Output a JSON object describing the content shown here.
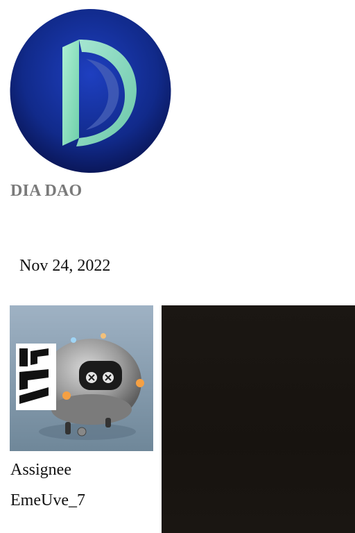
{
  "org": {
    "name": "DIA DAO",
    "logo_icon": "dia-dao-logo-icon",
    "colors": {
      "logo_bg_outer": "#0b1a63",
      "logo_bg_inner": "#1a37b5",
      "logo_glyph": "#8fe0c0"
    }
  },
  "post": {
    "date": "Nov 24, 2022"
  },
  "assignee": {
    "label": "Assignee",
    "name": "EmeUve_7",
    "avatar_icon": "robot-avatar-icon"
  },
  "media": {
    "panel_color": "#1a1612"
  }
}
